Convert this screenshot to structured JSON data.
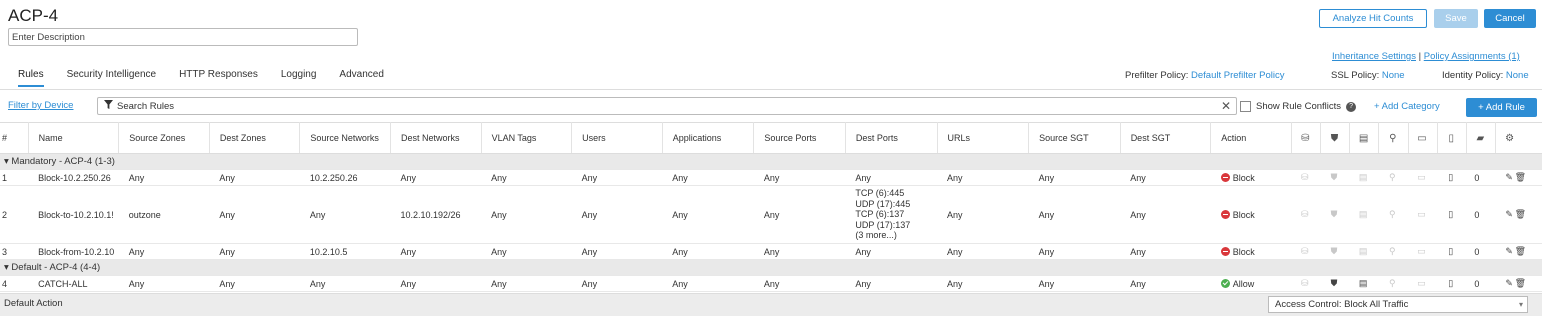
{
  "header": {
    "title": "ACP-4",
    "description_value": "Enter Description",
    "analyze_label": "Analyze Hit Counts",
    "save_label": "Save",
    "cancel_label": "Cancel",
    "inheritance_link": "Inheritance Settings",
    "separator": "|",
    "assignments_link": "Policy Assignments (1)"
  },
  "tabs": [
    "Rules",
    "Security Intelligence",
    "HTTP Responses",
    "Logging",
    "Advanced"
  ],
  "policies": {
    "prefilter_label": "Prefilter Policy:",
    "prefilter_value": "Default Prefilter Policy",
    "ssl_label": "SSL Policy:",
    "ssl_value": "None",
    "identity_label": "Identity Policy:",
    "identity_value": "None"
  },
  "toolbar": {
    "filter_link": "Filter by Device",
    "search_placeholder": "Search Rules",
    "show_conflicts": "Show Rule Conflicts",
    "add_category": "+ Add Category",
    "add_rule": "+ Add Rule"
  },
  "columns": [
    "#",
    "Name",
    "Source Zones",
    "Dest Zones",
    "Source Networks",
    "Dest Networks",
    "VLAN Tags",
    "Users",
    "Applications",
    "Source Ports",
    "Dest Ports",
    "URLs",
    "Source SGT",
    "Dest SGT",
    "Action"
  ],
  "groups": {
    "mandatory": "Mandatory - ACP-4 (1-3)",
    "default": "Default - ACP-4 (4-4)"
  },
  "rules": [
    {
      "num": "1",
      "name": "Block-10.2.250.26",
      "src_zones": "Any",
      "dst_zones": "Any",
      "src_net": "10.2.250.26",
      "dst_net": "Any",
      "vlan": "Any",
      "users": "Any",
      "apps": "Any",
      "src_ports": "Any",
      "dst_ports": [
        "Any"
      ],
      "urls": "Any",
      "src_sgt": "Any",
      "dst_sgt": "Any",
      "action": "Block",
      "count": "0"
    },
    {
      "num": "2",
      "name": "Block-to-10.2.10.1!",
      "src_zones": "outzone",
      "dst_zones": "Any",
      "src_net": "Any",
      "dst_net": "10.2.10.192/26",
      "vlan": "Any",
      "users": "Any",
      "apps": "Any",
      "src_ports": "Any",
      "dst_ports": [
        "TCP (6):445",
        "UDP (17):445",
        "TCP (6):137",
        "UDP (17):137",
        "(3 more...)"
      ],
      "urls": "Any",
      "src_sgt": "Any",
      "dst_sgt": "Any",
      "action": "Block",
      "count": "0"
    },
    {
      "num": "3",
      "name": "Block-from-10.2.10",
      "src_zones": "Any",
      "dst_zones": "Any",
      "src_net": "10.2.10.5",
      "dst_net": "Any",
      "vlan": "Any",
      "users": "Any",
      "apps": "Any",
      "src_ports": "Any",
      "dst_ports": [
        "Any"
      ],
      "urls": "Any",
      "src_sgt": "Any",
      "dst_sgt": "Any",
      "action": "Block",
      "count": "0"
    },
    {
      "num": "4",
      "name": "CATCH-ALL",
      "src_zones": "Any",
      "dst_zones": "Any",
      "src_net": "Any",
      "dst_net": "Any",
      "vlan": "Any",
      "users": "Any",
      "apps": "Any",
      "src_ports": "Any",
      "dst_ports": [
        "Any"
      ],
      "urls": "Any",
      "src_sgt": "Any",
      "dst_sgt": "Any",
      "action": "Allow",
      "count": "0"
    }
  ],
  "default_action": {
    "label": "Default Action",
    "value": "Access Control: Block All Traffic"
  },
  "colors": {
    "accent": "#2d8dd4",
    "block": "#d9373b",
    "allow": "#4caf50"
  }
}
